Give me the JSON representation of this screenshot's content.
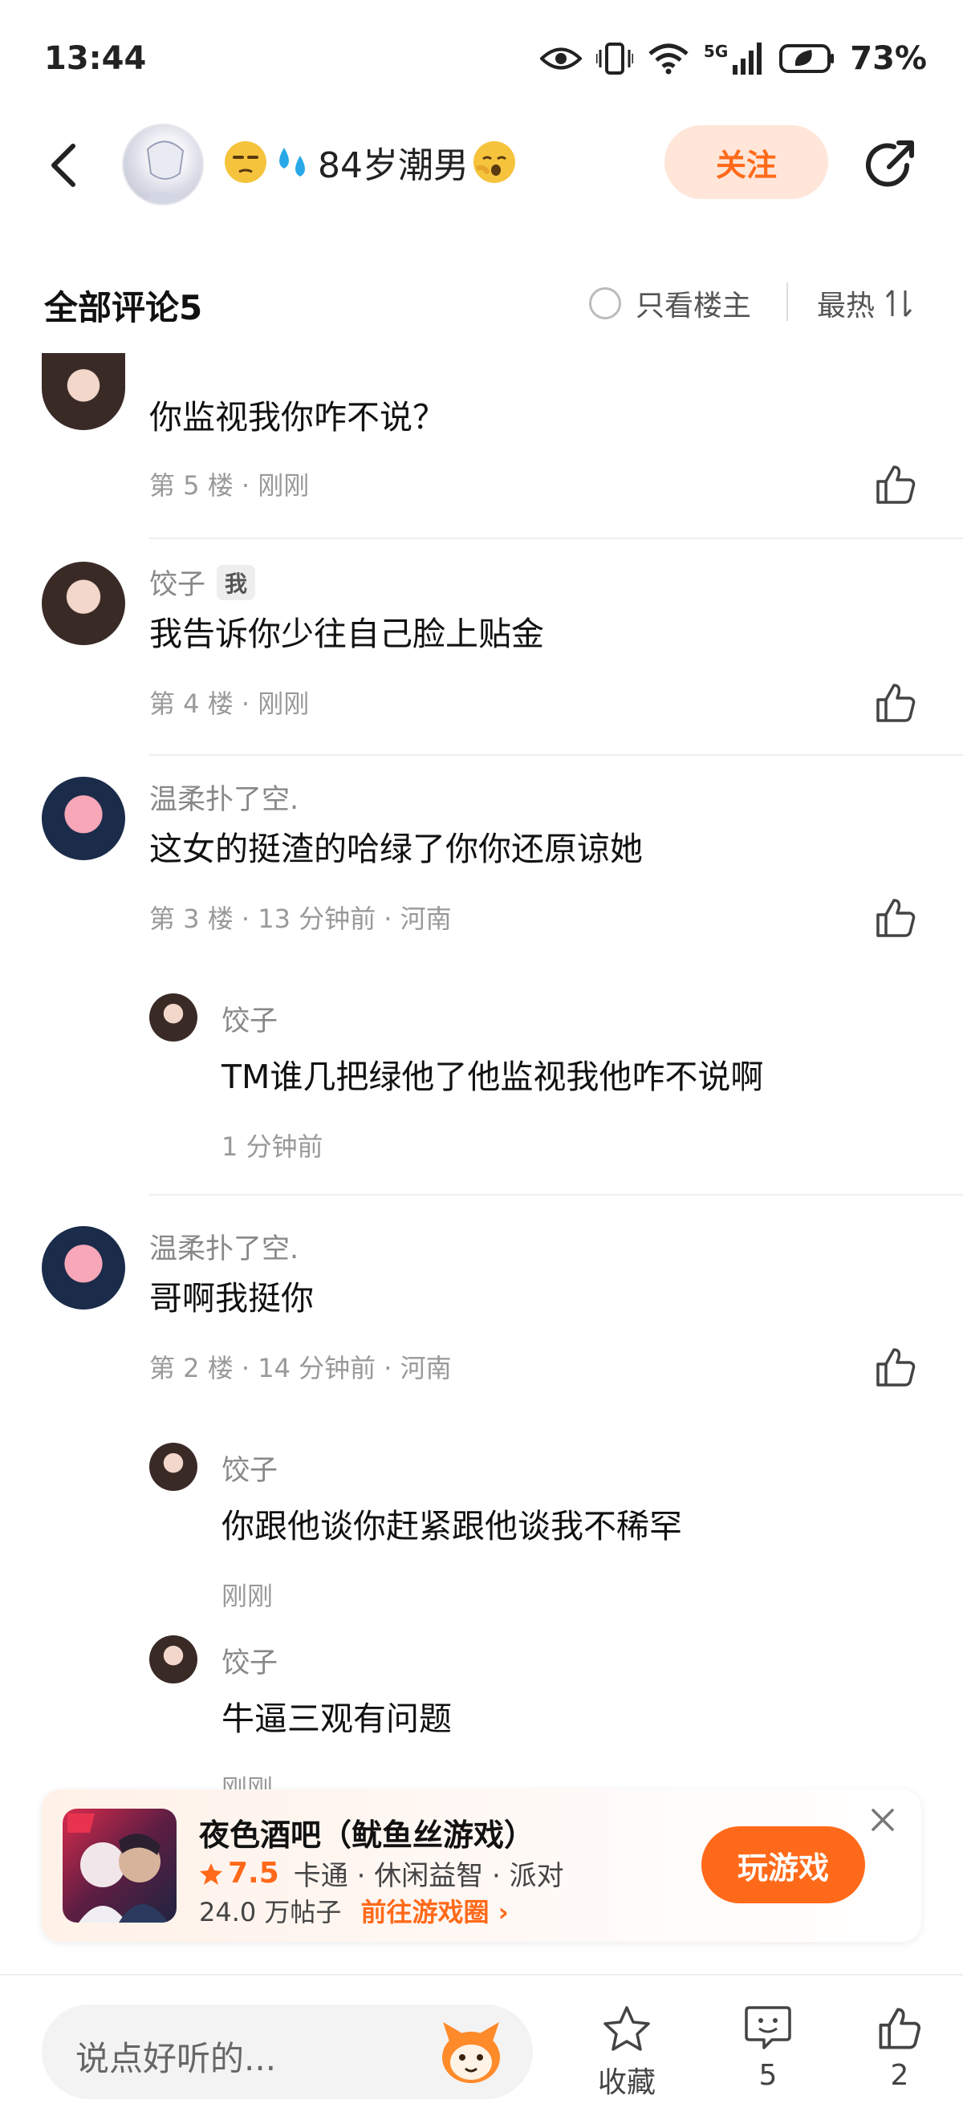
{
  "status_bar": {
    "time": "13:44",
    "network": "5G",
    "battery": "73%"
  },
  "header": {
    "username": "84岁潮男",
    "follow_label": "关注"
  },
  "comments_header": {
    "title": "全部评论5",
    "only_owner_label": "只看楼主",
    "sort_label": "最热"
  },
  "comments": [
    {
      "name": "",
      "badge": "",
      "text": "你监视我你咋不说？",
      "meta": "第 5 楼 · 刚刚"
    },
    {
      "name": "饺子",
      "badge": "我",
      "text": "我告诉你少往自己脸上贴金",
      "meta": "第 4 楼 · 刚刚"
    },
    {
      "name": "温柔扑了空.",
      "badge": "",
      "text": "这女的挺渣的哈绿了你你还原谅她",
      "meta": "第 3 楼 · 13 分钟前 · 河南",
      "replies": [
        {
          "name": "饺子",
          "text": "TM谁几把绿他了他监视我他咋不说啊",
          "meta": "1 分钟前"
        }
      ]
    },
    {
      "name": "温柔扑了空.",
      "badge": "",
      "text": "哥啊我挺你",
      "meta": "第 2 楼 · 14 分钟前 · 河南",
      "replies": [
        {
          "name": "饺子",
          "text": "你跟他谈你赶紧跟他谈我不稀罕",
          "meta": "刚刚"
        },
        {
          "name": "饺子",
          "text": "牛逼三观有问题",
          "meta": "刚刚"
        }
      ]
    }
  ],
  "game_ad": {
    "title": "夜色酒吧（鱿鱼丝游戏）",
    "score": "7.5",
    "tags": "卡通 · 休闲益智 · 派对",
    "posts": "24.0 万帖子",
    "link_label": "前往游戏圈",
    "play_label": "玩游戏",
    "accent": "#ff6a1a"
  },
  "bottom_bar": {
    "input_placeholder": "说点好听的...",
    "favorite_label": "收藏",
    "comment_count": "5",
    "like_count": "2"
  }
}
